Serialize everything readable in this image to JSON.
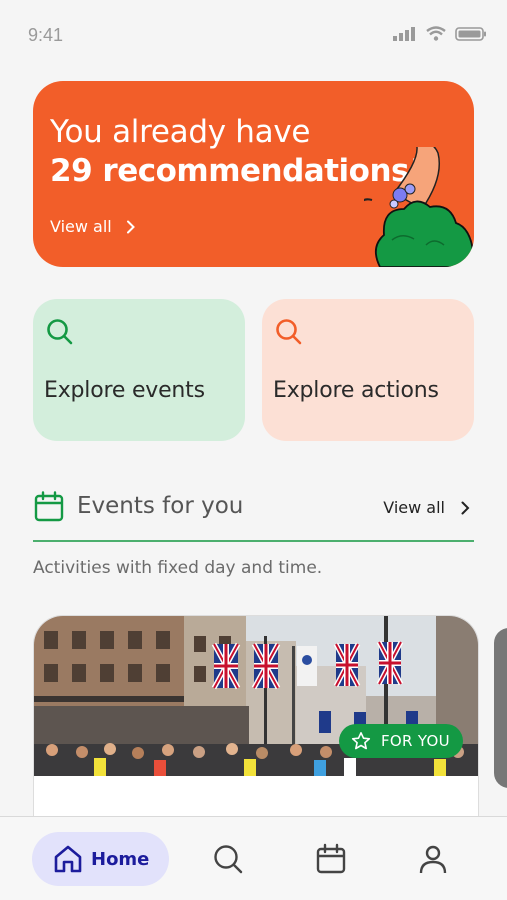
{
  "status_bar": {
    "time": "9:41"
  },
  "hero": {
    "line1": "You already have",
    "line2": "29 recommendations!",
    "link_label": "View all"
  },
  "explore": {
    "events_label": "Explore events",
    "actions_label": "Explore actions"
  },
  "events_section": {
    "title": "Events for you",
    "view_all_label": "View all",
    "subtitle": "Activities with fixed day and time."
  },
  "event_card": {
    "badge_label": "FOR YOU"
  },
  "bottom_nav": {
    "home_label": "Home"
  },
  "colors": {
    "hero_bg": "#f25e29",
    "events_card_bg": "#d3eedc",
    "actions_card_bg": "#fce0d5",
    "green_accent": "#149944",
    "nav_active_bg": "#e2e2fb",
    "nav_active_text": "#1c1c9c"
  },
  "icons": {
    "search_green": "search-icon",
    "search_orange": "search-icon",
    "calendar": "calendar-icon",
    "chevron": "chevron-right-icon",
    "star": "star-icon",
    "home": "home-icon",
    "user": "user-icon"
  }
}
